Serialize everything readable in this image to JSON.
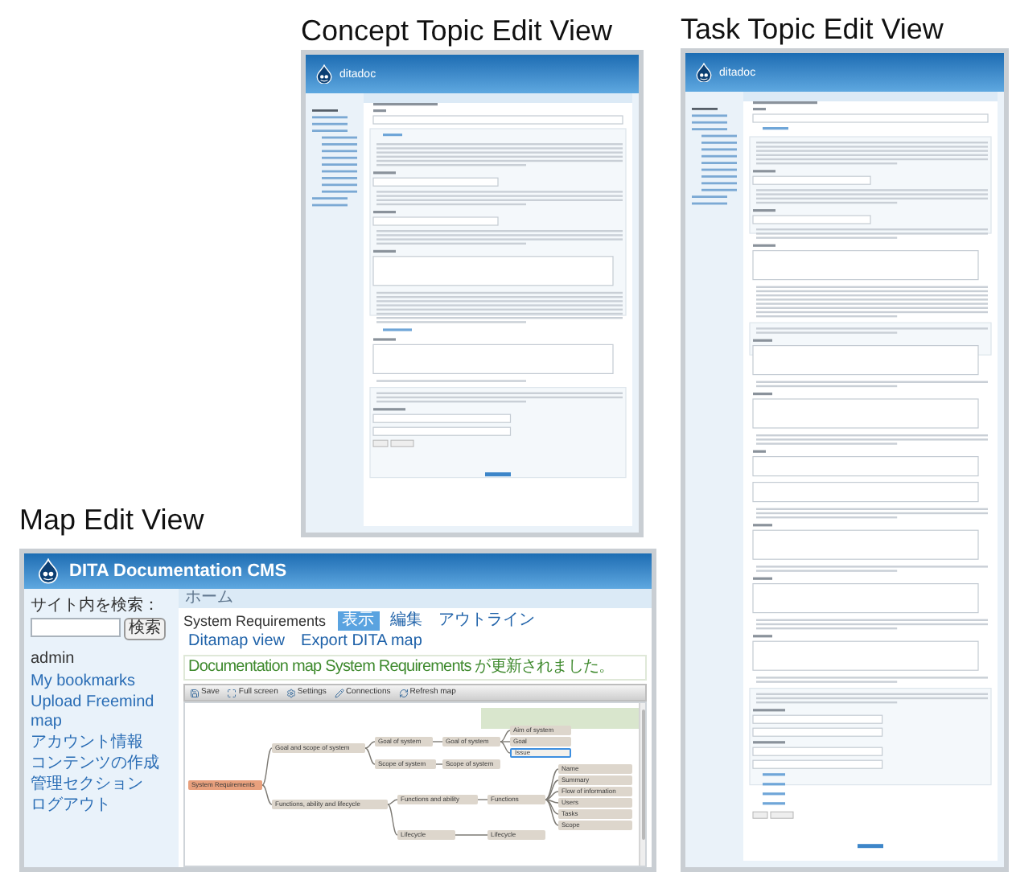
{
  "concept_view": {
    "caption": "Concept Topic Edit View",
    "site_name": "ditadoc"
  },
  "task_view": {
    "caption": "Task Topic Edit View",
    "site_name": "ditadoc"
  },
  "map_view": {
    "caption": "Map Edit View",
    "site_name": "DITA Documentation CMS",
    "breadcrumb": "ホーム",
    "search": {
      "label": "サイト内を検索：",
      "button": "検索"
    },
    "user": "admin",
    "menu": [
      "My bookmarks",
      "Upload Freemind map",
      "アカウント情報",
      "コンテンツの作成",
      "管理セクション",
      "ログアウト"
    ],
    "title": "System Requirements",
    "tabs": [
      {
        "label": "表示",
        "selected": true
      },
      {
        "label": "編集",
        "selected": false
      },
      {
        "label": "アウトライン",
        "selected": false
      },
      {
        "label": "Ditamap view",
        "selected": false
      },
      {
        "label": "Export DITA map",
        "selected": false
      }
    ],
    "message": "Documentation map System Requirements が更新されました。",
    "toolbar": [
      "Save",
      "Full screen",
      "Settings",
      "Connections",
      "Refresh map"
    ],
    "mindmap": {
      "label": "System Requirements",
      "selected": false,
      "children": [
        {
          "label": "Goal and scope of system",
          "selected": false,
          "children": [
            {
              "label": "Goal of system",
              "selected": false,
              "children": [
                {
                  "label": "Goal of system",
                  "selected": false,
                  "children": [
                    {
                      "label": "Aim of system",
                      "selected": false
                    },
                    {
                      "label": "Goal",
                      "selected": false
                    },
                    {
                      "label": "Issue",
                      "selected": true
                    }
                  ]
                }
              ]
            },
            {
              "label": "Scope of system",
              "selected": false,
              "children": [
                {
                  "label": "Scope of system",
                  "selected": false
                }
              ]
            }
          ]
        },
        {
          "label": "Functions, ability and lifecycle",
          "selected": false,
          "children": [
            {
              "label": "Functions and ability",
              "selected": false,
              "children": [
                {
                  "label": "Functions",
                  "selected": false,
                  "children": [
                    {
                      "label": "Name",
                      "selected": false
                    },
                    {
                      "label": "Summary",
                      "selected": false
                    },
                    {
                      "label": "Flow of information",
                      "selected": false
                    },
                    {
                      "label": "Users",
                      "selected": false
                    },
                    {
                      "label": "Tasks",
                      "selected": false
                    },
                    {
                      "label": "Scope",
                      "selected": false
                    }
                  ]
                }
              ]
            },
            {
              "label": "Lifecycle",
              "selected": false,
              "children": [
                {
                  "label": "Lifecycle",
                  "selected": false
                }
              ]
            }
          ]
        }
      ]
    }
  }
}
